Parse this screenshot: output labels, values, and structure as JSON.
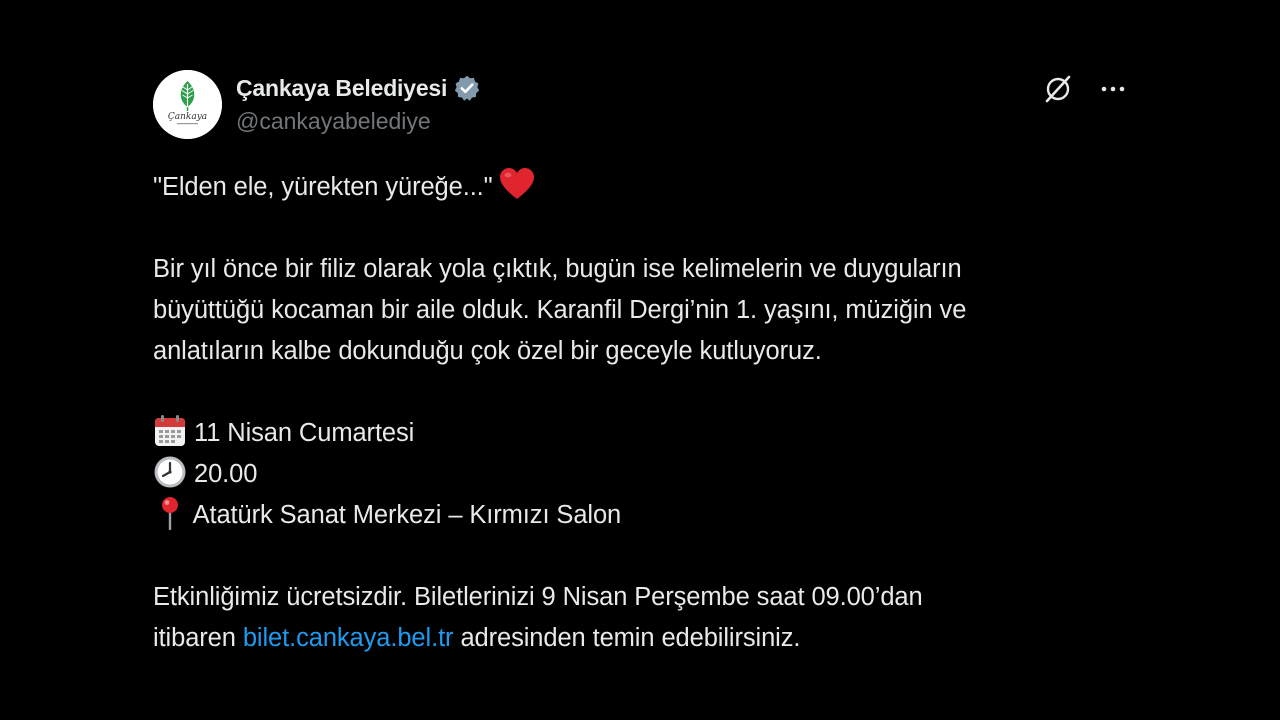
{
  "author": {
    "display_name": "Çankaya Belediyesi",
    "handle": "@cankayabelediye",
    "avatar_text": "Çankaya",
    "verified": true,
    "verified_color": "#829aab"
  },
  "actions": {
    "grok_icon": "grok-icon",
    "more_icon": "more-icon"
  },
  "tweet": {
    "line_quote": "\"Elden ele, yürekten yüreğe...\"",
    "quote_emoji": "red-heart",
    "paragraph_1": [
      "Bir yıl önce bir filiz olarak yola çıktık, bugün ise kelimelerin ve duyguların",
      "büyüttüğü kocaman bir aile olduk. Karanfil Dergi’nin 1. yaşını, müziğin ve",
      "anlatıların kalbe dokunduğu çok özel bir geceyle kutluyoruz."
    ],
    "date": "11 Nisan Cumartesi",
    "time": "20.00",
    "place": "Atatürk Sanat Merkezi – Kırmızı Salon",
    "paragraph_3_line_1": "Etkinliğimiz ücretsizdir. Biletlerinizi 9 Nisan Perşembe saat 09.00’dan",
    "paragraph_3_line_2_prefix": "itibaren ",
    "link_text": "bilet.cankaya.bel.tr",
    "paragraph_3_line_2_suffix": " adresinden temin edebilirsiniz."
  },
  "colors": {
    "background": "#000000",
    "text": "#e7e9ea",
    "secondary": "#71767b",
    "link": "#1d9bf0"
  }
}
